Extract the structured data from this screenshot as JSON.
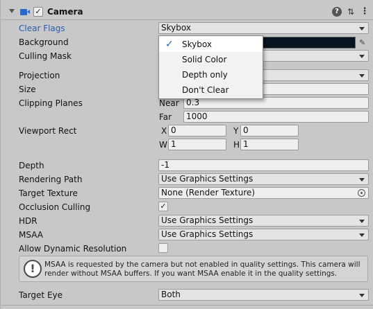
{
  "header": {
    "title": "Camera",
    "enabled": true,
    "icons": [
      "camera-icon",
      "help-icon",
      "presets-icon",
      "context-menu-icon"
    ]
  },
  "fields": {
    "clear_flags": {
      "label": "Clear Flags",
      "value": "Skybox"
    },
    "background": {
      "label": "Background",
      "color": "#08131f"
    },
    "culling_mask": {
      "label": "Culling Mask"
    },
    "projection": {
      "label": "Projection"
    },
    "size": {
      "label": "Size"
    },
    "clipping": {
      "label": "Clipping Planes",
      "near_label": "Near",
      "near": "0.3",
      "far_label": "Far",
      "far": "1000"
    },
    "viewport": {
      "label": "Viewport Rect",
      "x_label": "X",
      "x": "0",
      "y_label": "Y",
      "y": "0",
      "w_label": "W",
      "w": "1",
      "h_label": "H",
      "h": "1"
    },
    "depth": {
      "label": "Depth",
      "value": "-1"
    },
    "rendering_path": {
      "label": "Rendering Path",
      "value": "Use Graphics Settings"
    },
    "target_texture": {
      "label": "Target Texture",
      "value": "None (Render Texture)"
    },
    "occlusion_culling": {
      "label": "Occlusion Culling",
      "checked": true
    },
    "hdr": {
      "label": "HDR",
      "value": "Use Graphics Settings"
    },
    "msaa": {
      "label": "MSAA",
      "value": "Use Graphics Settings"
    },
    "dynamic_resolution": {
      "label": "Allow Dynamic Resolution",
      "checked": false
    },
    "target_eye": {
      "label": "Target Eye",
      "value": "Both"
    }
  },
  "help_box": {
    "text": "MSAA is requested by the camera but not enabled in quality settings. This camera will render without MSAA buffers. If you want MSAA enable it in the quality settings."
  },
  "dropdown": {
    "options": [
      "Skybox",
      "Solid Color",
      "Depth only",
      "Don't Clear"
    ],
    "selected": "Skybox"
  },
  "colors": {
    "accent": "#2a5db0",
    "panel": "#c8c8c8"
  }
}
